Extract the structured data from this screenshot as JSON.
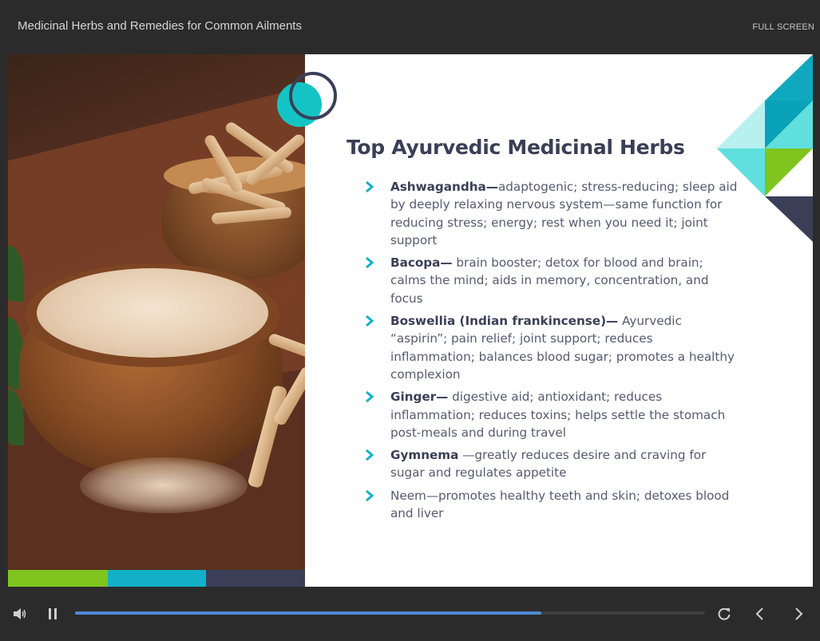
{
  "header": {
    "course_title": "Medicinal Herbs and Remedies for Common Ailments",
    "fullscreen_label": "FULL SCREEN"
  },
  "slide": {
    "title": "Top Ayurvedic Medicinal Herbs",
    "photo_icon": "ashwagandha-powder-photo",
    "herbs": [
      {
        "name": "Ashwagandha—",
        "description": "adaptogenic; stress-reducing; sleep aid by deeply relaxing nervous system—same function for reducing stress; energy; rest when you need it; joint support"
      },
      {
        "name": "Bacopa—",
        "description": " brain booster; detox for blood and brain; calms the mind; aids in memory, concentration, and focus"
      },
      {
        "name": "Boswellia (Indian frankincense)—",
        "description": " Ayurvedic “aspirin”; pain relief; joint support; reduces inflammation; balances blood sugar; promotes a healthy complexion"
      },
      {
        "name": "Ginger—",
        "description": " digestive aid; antioxidant; reduces inflammation; reduces toxins; helps settle the stomach post-meals and during travel"
      },
      {
        "name": "Gymnema",
        "description": " —greatly reduces desire and craving for sugar and regulates appetite"
      },
      {
        "name": "",
        "description": "Neem—promotes healthy teeth and skin; detoxes blood and liver"
      }
    ],
    "colors": {
      "navy": "#3a3f57",
      "teal": "#12b0c7",
      "green": "#7fc41f",
      "text": "#555b70"
    }
  },
  "player": {
    "progress": 0.74,
    "icons": [
      "volume-icon",
      "pause-icon",
      "replay-icon",
      "prev-arrow-icon",
      "next-arrow-icon"
    ]
  }
}
